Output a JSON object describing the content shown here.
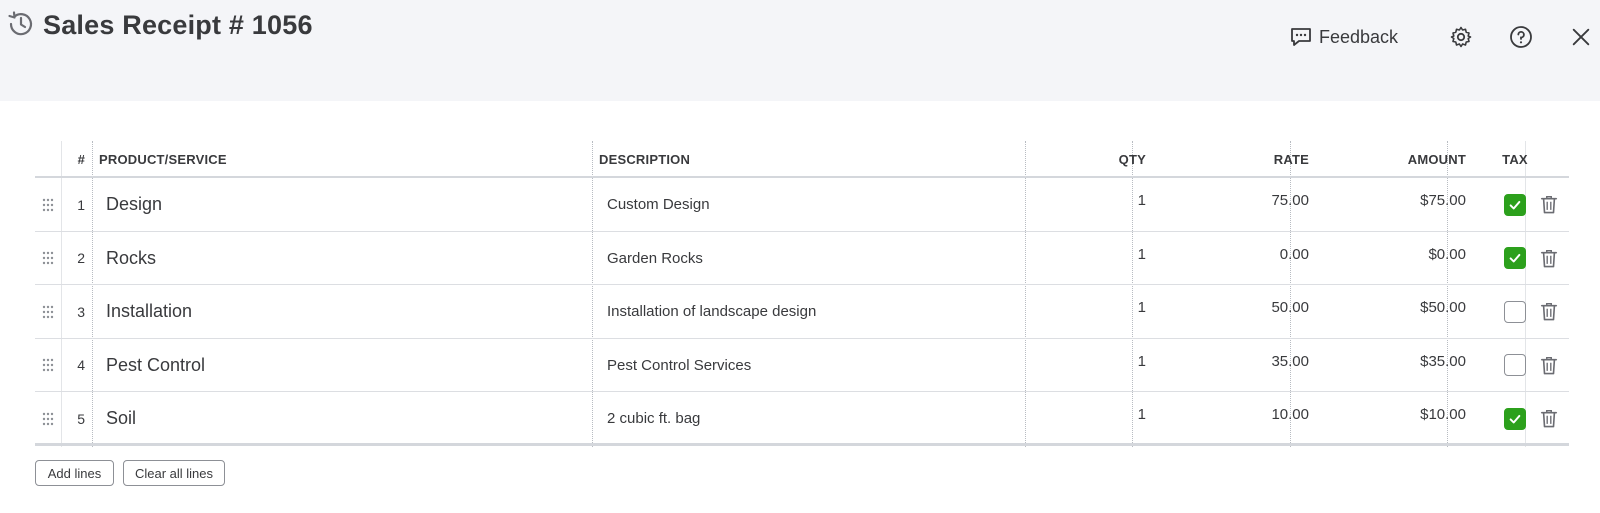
{
  "header": {
    "title": "Sales Receipt # 1056",
    "feedback_label": "Feedback",
    "icons": {
      "history": "history-icon",
      "feedback": "speech-bubble-icon",
      "settings": "gear-icon",
      "help": "help-icon",
      "close": "close-icon"
    }
  },
  "table": {
    "columns": {
      "num": "#",
      "product": "PRODUCT/SERVICE",
      "description": "DESCRIPTION",
      "qty": "QTY",
      "rate": "RATE",
      "amount": "AMOUNT",
      "tax": "TAX"
    },
    "rows": [
      {
        "num": "1",
        "product": "Design",
        "description": "Custom Design",
        "qty": "1",
        "rate": "75.00",
        "amount": "$75.00",
        "tax": true
      },
      {
        "num": "2",
        "product": "Rocks",
        "description": "Garden Rocks",
        "qty": "1",
        "rate": "0.00",
        "amount": "$0.00",
        "tax": true
      },
      {
        "num": "3",
        "product": "Installation",
        "description": "Installation of landscape design",
        "qty": "1",
        "rate": "50.00",
        "amount": "$50.00",
        "tax": false
      },
      {
        "num": "4",
        "product": "Pest Control",
        "description": "Pest Control Services",
        "qty": "1",
        "rate": "35.00",
        "amount": "$35.00",
        "tax": false
      },
      {
        "num": "5",
        "product": "Soil",
        "description": "2 cubic ft. bag",
        "qty": "1",
        "rate": "10.00",
        "amount": "$10.00",
        "tax": true
      }
    ]
  },
  "footer": {
    "add_lines_label": "Add lines",
    "clear_all_lines_label": "Clear all lines"
  },
  "colors": {
    "header_bg": "#f4f5f8",
    "text": "#393a3d",
    "checkbox_checked": "#2ca01c",
    "icon_gray": "#8d9096"
  }
}
